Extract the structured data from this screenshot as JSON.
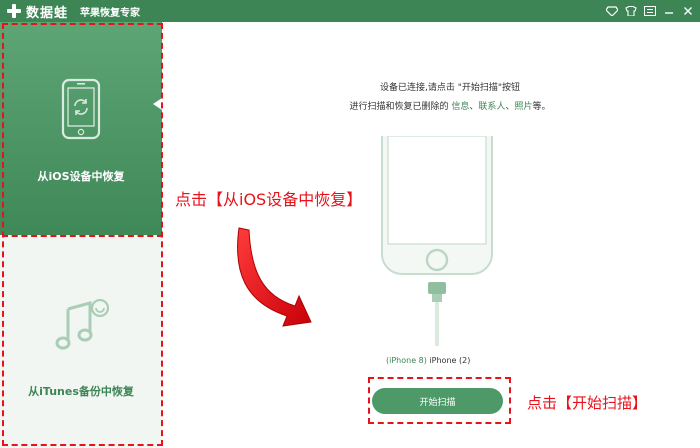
{
  "titlebar": {
    "brand": "数据蛙",
    "product": "苹果恢复专家",
    "icons": [
      "diamond-icon",
      "shirt-icon",
      "menu-icon",
      "minimize-icon",
      "close-icon"
    ]
  },
  "sidebar": {
    "items": [
      {
        "label": "从iOS设备中恢复",
        "icon": "phone-refresh-icon",
        "active": true
      },
      {
        "label": "从iTunes备份中恢复",
        "icon": "music-note-icon",
        "active": false
      }
    ]
  },
  "main": {
    "line1": "设备已连接,请点击 \"开始扫描\"按钮",
    "line2_prefix": "进行扫描和恢复已删除的 ",
    "line2_info": "信息",
    "line2_sep1": "、",
    "line2_contacts": "联系人",
    "line2_sep2": "、",
    "line2_photos": "照片",
    "line2_suffix": "等。",
    "device_model": "(iPhone 8)",
    "device_name": " iPhone (2)",
    "start_button": "开始扫描"
  },
  "annotations": {
    "sidebar_hint": "点击【从iOS设备中恢复】",
    "button_hint": "点击【开始扫描】"
  },
  "colors": {
    "brand_green": "#3d8555",
    "annotation_red": "#e8121a"
  }
}
